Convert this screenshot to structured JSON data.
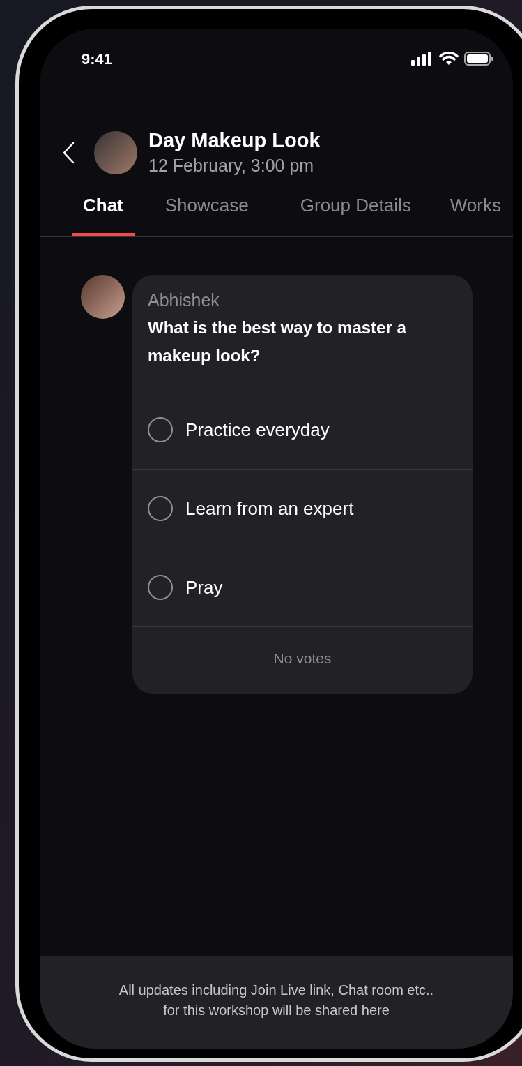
{
  "status_bar": {
    "time": "9:41"
  },
  "header": {
    "title": "Day Makeup Look",
    "subtitle": "12 February, 3:00 pm"
  },
  "tabs": [
    {
      "label": "Chat",
      "selected": true
    },
    {
      "label": "Showcase",
      "selected": false
    },
    {
      "label": "Group Details",
      "selected": false
    },
    {
      "label": "Works",
      "selected": false
    }
  ],
  "message": {
    "sender": "Abhishek",
    "poll": {
      "question": "What is the best way to master a makeup look?",
      "options": [
        {
          "label": "Practice everyday",
          "selected": false
        },
        {
          "label": "Learn from an expert",
          "selected": false
        },
        {
          "label": "Pray",
          "selected": false
        }
      ],
      "footer": "No votes"
    }
  },
  "notice": [
    "All updates including Join Live link, Chat room etc..",
    "for this workshop will be shared here"
  ]
}
